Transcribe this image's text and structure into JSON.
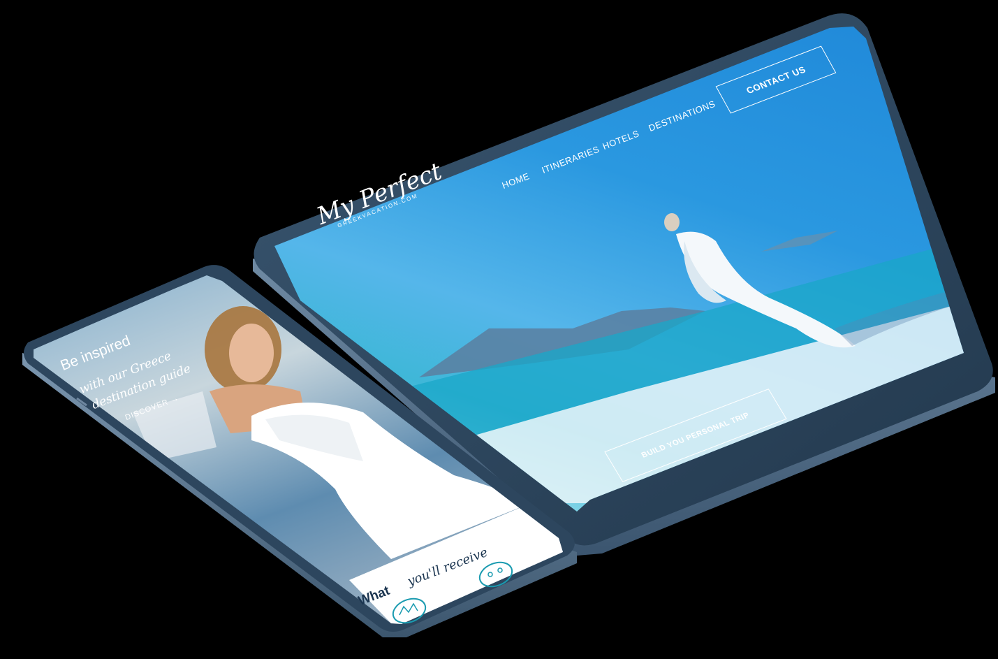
{
  "tablet": {
    "logo": {
      "script": "My Perfect",
      "subtitle": "GREEKVACATION.COM"
    },
    "nav": {
      "home": "HOME",
      "itineraries": "ITINERARIES",
      "hotels": "HOTELS",
      "destinations": "DESTINATIONS"
    },
    "contact_label": "CONTACT US",
    "cta_label": "BUILD YOU PERSONAL TRIP"
  },
  "phone": {
    "headline": "Be inspired",
    "subline_1": "with our Greece",
    "subline_2": "destination guide",
    "discover_label": "DISCOVER",
    "section_title_bold": "What",
    "section_title_script": "you'll receive"
  },
  "colors": {
    "sky": "#1e86d8",
    "sea": "#3fb7d8",
    "frame": "#2f4a63",
    "navy": "#1b3550"
  }
}
